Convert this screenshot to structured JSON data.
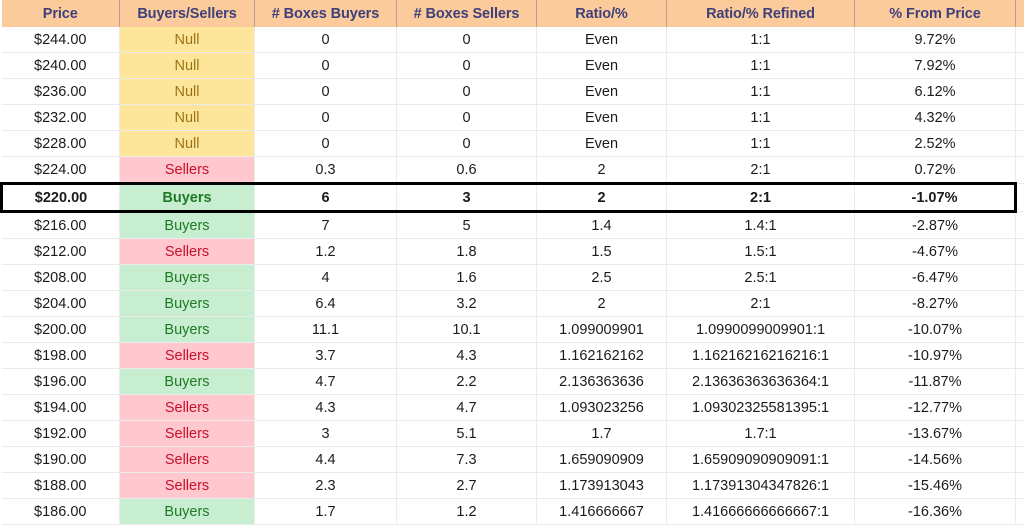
{
  "table": {
    "columns": [
      {
        "key": "price",
        "label": "Price"
      },
      {
        "key": "bs",
        "label": "Buyers/Sellers"
      },
      {
        "key": "bb",
        "label": "# Boxes Buyers"
      },
      {
        "key": "bsx",
        "label": "# Boxes Sellers"
      },
      {
        "key": "ratio",
        "label": "Ratio/%"
      },
      {
        "key": "refined",
        "label": "Ratio/% Refined"
      },
      {
        "key": "pct",
        "label": "% From Price"
      }
    ],
    "colors": {
      "header_bg": "#fbcb9c",
      "header_text": "#3f3f7a",
      "null_bg": "#fde59a",
      "null_text": "#9a7518",
      "buyers_bg": "#c7eed0",
      "buyers_text": "#1e7a23",
      "sellers_bg": "#ffc8ce",
      "sellers_text": "#c8102e",
      "highlight_border": "#000000",
      "gridline": "#ebebeb"
    },
    "rows": [
      {
        "price": "$244.00",
        "bs": "Null",
        "status": "null",
        "bb": "0",
        "bsx": "0",
        "ratio": "Even",
        "refined": "1:1",
        "pct": "9.72%",
        "highlight": false
      },
      {
        "price": "$240.00",
        "bs": "Null",
        "status": "null",
        "bb": "0",
        "bsx": "0",
        "ratio": "Even",
        "refined": "1:1",
        "pct": "7.92%",
        "highlight": false
      },
      {
        "price": "$236.00",
        "bs": "Null",
        "status": "null",
        "bb": "0",
        "bsx": "0",
        "ratio": "Even",
        "refined": "1:1",
        "pct": "6.12%",
        "highlight": false
      },
      {
        "price": "$232.00",
        "bs": "Null",
        "status": "null",
        "bb": "0",
        "bsx": "0",
        "ratio": "Even",
        "refined": "1:1",
        "pct": "4.32%",
        "highlight": false
      },
      {
        "price": "$228.00",
        "bs": "Null",
        "status": "null",
        "bb": "0",
        "bsx": "0",
        "ratio": "Even",
        "refined": "1:1",
        "pct": "2.52%",
        "highlight": false
      },
      {
        "price": "$224.00",
        "bs": "Sellers",
        "status": "sellers",
        "bb": "0.3",
        "bsx": "0.6",
        "ratio": "2",
        "refined": "2:1",
        "pct": "0.72%",
        "highlight": false
      },
      {
        "price": "$220.00",
        "bs": "Buyers",
        "status": "buyers",
        "bb": "6",
        "bsx": "3",
        "ratio": "2",
        "refined": "2:1",
        "pct": "-1.07%",
        "highlight": true
      },
      {
        "price": "$216.00",
        "bs": "Buyers",
        "status": "buyers",
        "bb": "7",
        "bsx": "5",
        "ratio": "1.4",
        "refined": "1.4:1",
        "pct": "-2.87%",
        "highlight": false
      },
      {
        "price": "$212.00",
        "bs": "Sellers",
        "status": "sellers",
        "bb": "1.2",
        "bsx": "1.8",
        "ratio": "1.5",
        "refined": "1.5:1",
        "pct": "-4.67%",
        "highlight": false
      },
      {
        "price": "$208.00",
        "bs": "Buyers",
        "status": "buyers",
        "bb": "4",
        "bsx": "1.6",
        "ratio": "2.5",
        "refined": "2.5:1",
        "pct": "-6.47%",
        "highlight": false
      },
      {
        "price": "$204.00",
        "bs": "Buyers",
        "status": "buyers",
        "bb": "6.4",
        "bsx": "3.2",
        "ratio": "2",
        "refined": "2:1",
        "pct": "-8.27%",
        "highlight": false
      },
      {
        "price": "$200.00",
        "bs": "Buyers",
        "status": "buyers",
        "bb": "11.1",
        "bsx": "10.1",
        "ratio": "1.099009901",
        "refined": "1.0990099009901:1",
        "pct": "-10.07%",
        "highlight": false
      },
      {
        "price": "$198.00",
        "bs": "Sellers",
        "status": "sellers",
        "bb": "3.7",
        "bsx": "4.3",
        "ratio": "1.162162162",
        "refined": "1.16216216216216:1",
        "pct": "-10.97%",
        "highlight": false
      },
      {
        "price": "$196.00",
        "bs": "Buyers",
        "status": "buyers",
        "bb": "4.7",
        "bsx": "2.2",
        "ratio": "2.136363636",
        "refined": "2.13636363636364:1",
        "pct": "-11.87%",
        "highlight": false
      },
      {
        "price": "$194.00",
        "bs": "Sellers",
        "status": "sellers",
        "bb": "4.3",
        "bsx": "4.7",
        "ratio": "1.093023256",
        "refined": "1.09302325581395:1",
        "pct": "-12.77%",
        "highlight": false
      },
      {
        "price": "$192.00",
        "bs": "Sellers",
        "status": "sellers",
        "bb": "3",
        "bsx": "5.1",
        "ratio": "1.7",
        "refined": "1.7:1",
        "pct": "-13.67%",
        "highlight": false
      },
      {
        "price": "$190.00",
        "bs": "Sellers",
        "status": "sellers",
        "bb": "4.4",
        "bsx": "7.3",
        "ratio": "1.659090909",
        "refined": "1.65909090909091:1",
        "pct": "-14.56%",
        "highlight": false
      },
      {
        "price": "$188.00",
        "bs": "Sellers",
        "status": "sellers",
        "bb": "2.3",
        "bsx": "2.7",
        "ratio": "1.173913043",
        "refined": "1.17391304347826:1",
        "pct": "-15.46%",
        "highlight": false
      },
      {
        "price": "$186.00",
        "bs": "Buyers",
        "status": "buyers",
        "bb": "1.7",
        "bsx": "1.2",
        "ratio": "1.416666667",
        "refined": "1.41666666666667:1",
        "pct": "-16.36%",
        "highlight": false
      }
    ]
  }
}
